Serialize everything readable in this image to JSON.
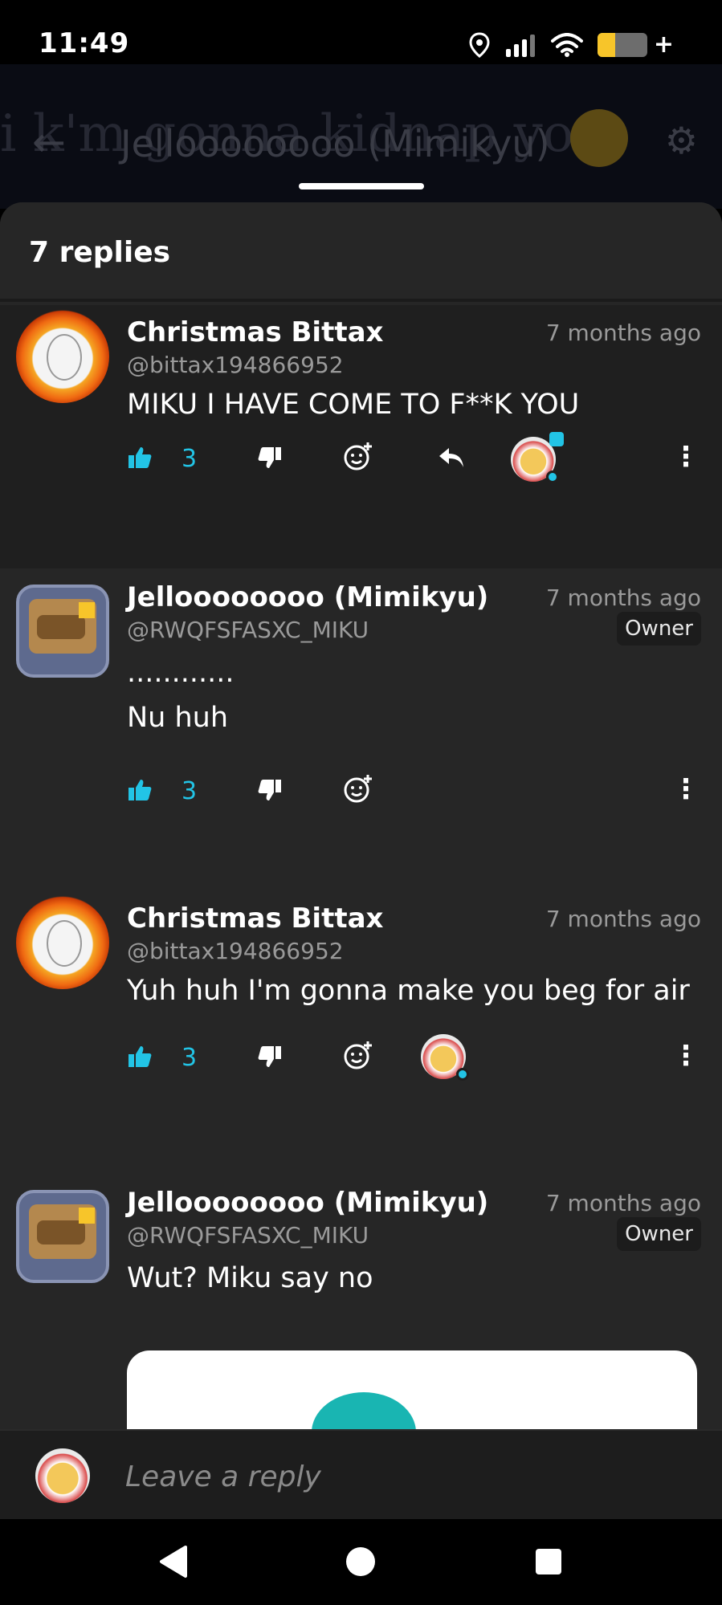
{
  "status_bar": {
    "time": "11:49",
    "icons": [
      "location-icon",
      "signal-icon",
      "wifi-icon",
      "battery-charging-icon"
    ]
  },
  "background_header": {
    "title": "Jelloooooooo (Mimikyu)",
    "ghost_text": "i k'm gonna kidnap you"
  },
  "sheet": {
    "replies_count": "7 replies"
  },
  "comments": [
    {
      "username": "Christmas Bittax",
      "handle": "@bittax194866952",
      "time": "7 months ago",
      "text": "MIKU I HAVE COME TO F**K YOU",
      "likes": "3"
    },
    {
      "username": "Jelloooooooo (Mimikyu)",
      "handle": "@RWQFSFASXC_MIKU",
      "time": "7 months ago",
      "badge": "Owner",
      "text_line1": "............",
      "text_line2": "Nu huh",
      "likes": "3"
    },
    {
      "username": "Christmas Bittax",
      "handle": "@bittax194866952",
      "time": "7 months ago",
      "text": "Yuh huh I'm gonna make you beg for air",
      "likes": "3"
    },
    {
      "username": "Jelloooooooo (Mimikyu)",
      "handle": "@RWQFSFASXC_MIKU",
      "time": "7 months ago",
      "badge": "Owner",
      "text": "Wut? Miku say no"
    }
  ],
  "reply_bar": {
    "placeholder": "Leave a reply"
  },
  "colors": {
    "accent": "#22c4e6",
    "sheet_bg": "#262626",
    "highlight_bg": "#1f1f1f"
  }
}
